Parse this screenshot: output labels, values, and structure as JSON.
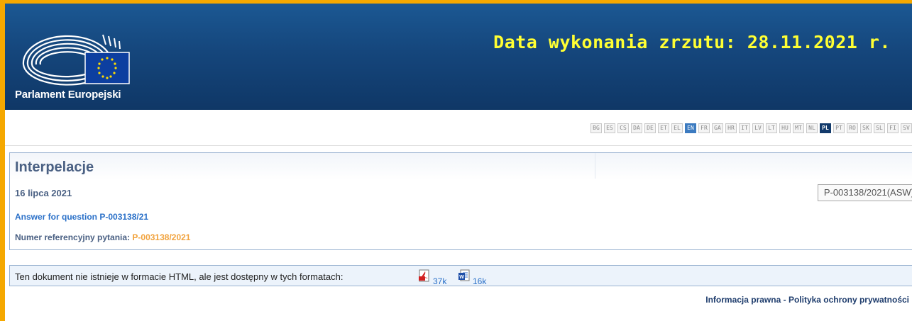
{
  "header": {
    "logo_text": "Parlament Europejski",
    "capture_date": "Data wykonania zrzutu: 28.11.2021 r."
  },
  "languages": {
    "items": [
      "BG",
      "ES",
      "CS",
      "DA",
      "DE",
      "ET",
      "EL",
      "EN",
      "FR",
      "GA",
      "HR",
      "IT",
      "LV",
      "LT",
      "HU",
      "MT",
      "NL",
      "PL",
      "PT",
      "RO",
      "SK",
      "SL",
      "FI",
      "SV"
    ],
    "highlighted": "EN",
    "selected": "PL"
  },
  "document": {
    "section_title": "Interpelacje",
    "date": "16 lipca 2021",
    "reference_box": "P-003138/2021(ASW)",
    "answer_link": "Answer for question P-003138/21",
    "ref_label": "Numer referencyjny pytania:",
    "ref_value": "P-003138/2021"
  },
  "formats": {
    "note": "Ten dokument nie istnieje w formacie HTML, ale jest dostępny w tych formatach:",
    "pdf": {
      "icon": "pdf-icon",
      "size": "37k"
    },
    "word": {
      "icon": "word-icon",
      "size": "16k"
    }
  },
  "footer": {
    "legal": "Informacja prawna",
    "separator": "-",
    "privacy": "Polityka ochrony prywatności"
  },
  "colors": {
    "frame": "#f5a800",
    "header_blue": "#15467c",
    "capture_text": "#ffff33",
    "title": "#4a6083",
    "link": "#2a70c8",
    "reference_orange": "#f1a23c"
  }
}
